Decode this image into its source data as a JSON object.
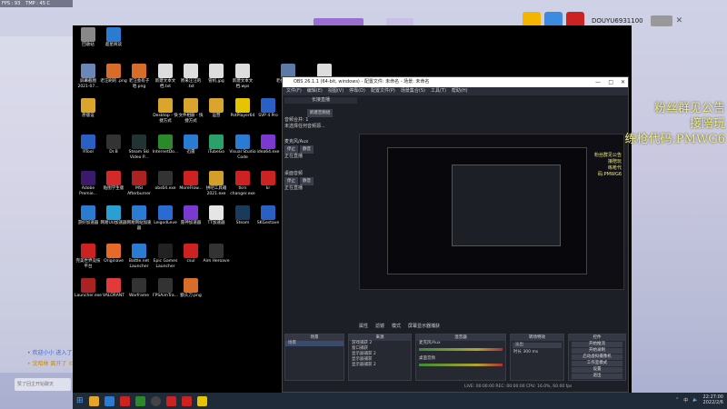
{
  "stats": {
    "fps": "FPS : 93",
    "tmp": "TMP : 45 C"
  },
  "user": {
    "name": "DOUYU6931100"
  },
  "chat": {
    "line1": "• 欢迎小小 进入了直播间",
    "line2": "• 沈哈林 离开了 ©",
    "input_placeholder": "赞了回主开始聊天"
  },
  "desktop_icons": [
    {
      "label": "回收站",
      "color": "#888"
    },
    {
      "label": "超星阅读",
      "color": "#2a7bd2"
    },
    {
      "label": "屏幕截图 2021-07...",
      "color": "#6a87b7"
    },
    {
      "label": "老汪刷的 .png",
      "color": "#d86d2a"
    },
    {
      "label": "老汪会有子 哈.png",
      "color": "#d86d2a"
    },
    {
      "label": "新建文本文 档.txt",
      "color": "#ddd"
    },
    {
      "label": "原来汪汪的 .txt",
      "color": "#ddd"
    },
    {
      "label": "管机.jpg",
      "color": "#ddd"
    },
    {
      "label": "新建文本文 档.wps",
      "color": "#ddd"
    },
    {
      "label": "老板小刀.jpg",
      "color": "#5b7aa5"
    },
    {
      "label": "Run CareGuiler",
      "color": "#ddd"
    },
    {
      "label": "原版设",
      "color": "#d9a52d"
    },
    {
      "label": "Desktop - 快捷方式",
      "color": "#d9a52d"
    },
    {
      "label": "文件相册 - 快捷方式",
      "color": "#d9a52d"
    },
    {
      "label": "运营",
      "color": "#d9a52d"
    },
    {
      "label": "PotPlayer64",
      "color": "#e5c400"
    },
    {
      "label": "SVP 4 Pro",
      "color": "#2a5fc4"
    },
    {
      "label": "RTool",
      "color": "#2a5fc4"
    },
    {
      "label": "Dr.B",
      "color": "#333"
    },
    {
      "label": "Steam Ski Video P...",
      "color": "#233"
    },
    {
      "label": "InternetDo...",
      "color": "#2a8a2a"
    },
    {
      "label": "迅雷",
      "color": "#2a7bd2"
    },
    {
      "label": "iTubeGo",
      "color": "#2aa06a"
    },
    {
      "label": "Visual Studio Code",
      "color": "#2a7bd2"
    },
    {
      "label": "idea64.exe",
      "color": "#7a3ad2"
    },
    {
      "label": "Adobe Premie...",
      "color": "#3a1a6a"
    },
    {
      "label": "贴图学生版",
      "color": "#d22a2a"
    },
    {
      "label": "MSI Afterburner",
      "color": "#a22"
    },
    {
      "label": "obs64.exe",
      "color": "#333"
    },
    {
      "label": "MoreFlow...",
      "color": "#c22"
    },
    {
      "label": "拼吧工具箱 2021.exe",
      "color": "#d2a02a"
    },
    {
      "label": "tkrn changer.exe",
      "color": "#c22"
    },
    {
      "label": "kr",
      "color": "#c22"
    },
    {
      "label": "游好加速器",
      "color": "#2a7bd2"
    },
    {
      "label": "网易UU加速器",
      "color": "#2aa0d2"
    },
    {
      "label": "网易网站加速器",
      "color": "#2a7bd2"
    },
    {
      "label": "LeigodLeve",
      "color": "#2a6ad2"
    },
    {
      "label": "雷神加速器",
      "color": "#7a3ad2"
    },
    {
      "label": "TT加速器",
      "color": "#e5e5e5"
    },
    {
      "label": "Steam",
      "color": "#1a3a5a"
    },
    {
      "label": "SKGestave",
      "color": "#2a5fc4"
    },
    {
      "label": "完美世界竞技平台",
      "color": "#c22"
    },
    {
      "label": "Originave",
      "color": "#e56a2a"
    },
    {
      "label": "Battle.net Launcher",
      "color": "#2a7bd2"
    },
    {
      "label": "Epic Games Launcher",
      "color": "#222"
    },
    {
      "label": "csul",
      "color": "#c22"
    },
    {
      "label": "Aim Heroave",
      "color": "#333"
    },
    {
      "label": "Launcher.exe",
      "color": "#a22"
    },
    {
      "label": "VALORANT",
      "color": "#e23a3a"
    },
    {
      "label": "Warframe",
      "color": "#333"
    },
    {
      "label": "FPSAimTra...",
      "color": "#333"
    },
    {
      "label": "额头刀.png",
      "color": "#d86d2a"
    }
  ],
  "obs": {
    "title": "OBS 26.1.1 (64-bit, windows) - 配置文件: 未命名 - 场景: 未命名",
    "menu": [
      "文件(F)",
      "编辑(E)",
      "视图(V)",
      "停靠(D)",
      "配置文件(P)",
      "场景集合(S)",
      "工具(T)",
      "帮助(H)"
    ],
    "left_panel": {
      "header": "长接直播",
      "btn": "新建音频组",
      "line1": "音频合并: 1",
      "line2": "未选择任何音频源...",
      "mic_label": "麦克风/Aux",
      "desktop_label": "桌面音频",
      "status1": "正在直播",
      "status2": "正在直播"
    },
    "controls": [
      "属性",
      "滤镜",
      "模式",
      "屏幕显示器捕获"
    ],
    "docks": {
      "scenes": "场景",
      "sources": "来源",
      "mixer": "混音器",
      "transitions": "转场特效",
      "controls": "控件"
    },
    "scene_item": "场景",
    "source_items": [
      "游戏捕获 2",
      "窗口捕获",
      "显示器捕获 2",
      "显示器捕获",
      "显示器捕获 2"
    ],
    "mixer_items": [
      "麦克风/Aux",
      "桌面音频"
    ],
    "transition": {
      "name": "淡出",
      "duration_label": "时长",
      "duration": "300 ms"
    },
    "control_buttons": [
      "开始推流",
      "开始录制",
      "启动虚拟摄像机",
      "工作室模式",
      "设置",
      "退出"
    ],
    "status": "LIVE: 00:00:00  REC: 00:00:00  CPU: 16.0%, 60.00 fps"
  },
  "overlay": {
    "line1": "粉丝群见公告",
    "line2": "接陪玩",
    "line3": "练枪代码:PMWG6"
  },
  "taskbar": {
    "time": "22:27:00",
    "date": "2022/2/6",
    "lang": "中"
  }
}
